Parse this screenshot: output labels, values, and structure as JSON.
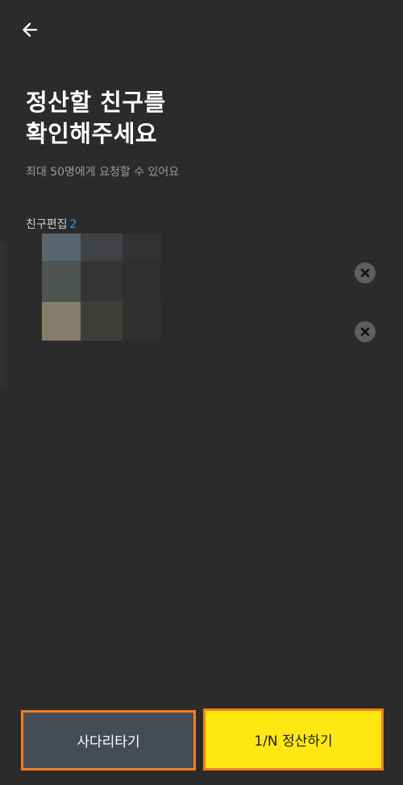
{
  "header": {
    "back_icon": "arrow-left-icon"
  },
  "title": "정산할 친구를\n확인해주세요",
  "subtitle": "최대 50명에게 요청할 수 있어요",
  "friend_edit": {
    "label": "친구편집",
    "count": "2"
  },
  "friends": [
    {
      "remove_icon": "close-icon"
    },
    {
      "remove_icon": "close-icon"
    }
  ],
  "buttons": {
    "ladder": "사다리타기",
    "split": "1/N 정산하기"
  },
  "colors": {
    "background": "#2b2b2b",
    "accent_yellow": "#ffe812",
    "highlight_orange": "#f47f1f",
    "count_blue": "#3b95f0"
  }
}
